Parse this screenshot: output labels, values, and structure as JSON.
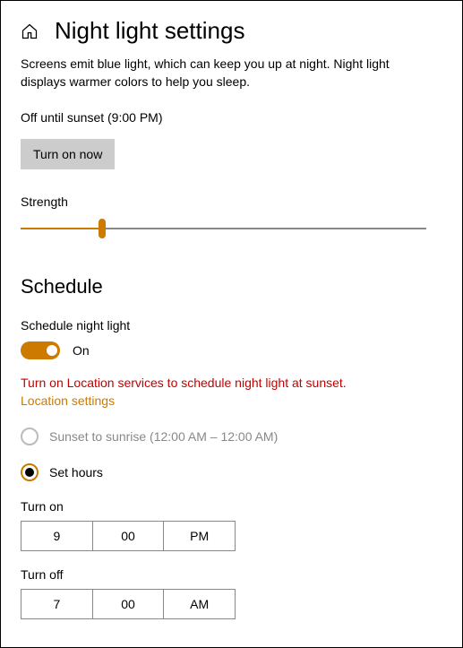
{
  "header": {
    "title": "Night light settings"
  },
  "description": "Screens emit blue light, which can keep you up at night. Night light displays warmer colors to help you sleep.",
  "status": "Off until sunset (9:00 PM)",
  "turn_on_button": "Turn on now",
  "strength": {
    "label": "Strength",
    "value_percent": 20
  },
  "schedule": {
    "title": "Schedule",
    "toggle_label": "Schedule night light",
    "toggle_state": "On",
    "warning": "Turn on Location services to schedule night light at sunset.",
    "location_link": "Location settings",
    "options": {
      "sunset": "Sunset to sunrise (12:00 AM – 12:00 AM)",
      "set_hours": "Set hours"
    },
    "turn_on": {
      "label": "Turn on",
      "hour": "9",
      "minute": "00",
      "period": "PM"
    },
    "turn_off": {
      "label": "Turn off",
      "hour": "7",
      "minute": "00",
      "period": "AM"
    }
  }
}
